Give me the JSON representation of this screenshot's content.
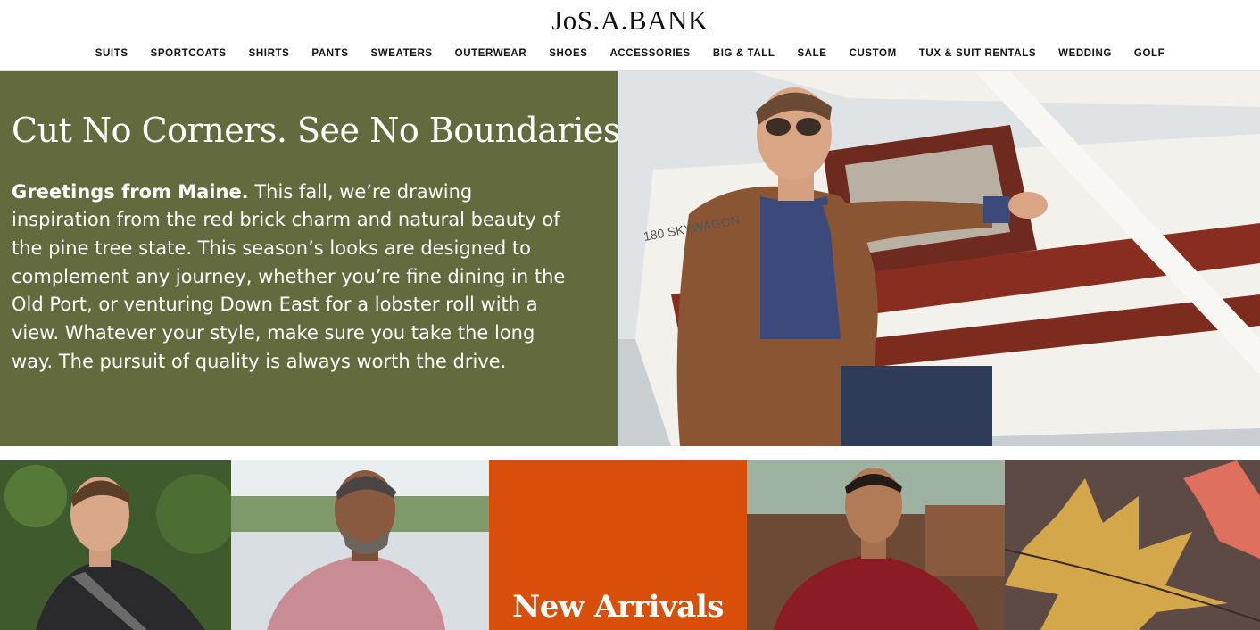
{
  "brand": {
    "logo": "JoS.A.BANK"
  },
  "nav": {
    "items": [
      {
        "label": "SUITS"
      },
      {
        "label": "SPORTCOATS"
      },
      {
        "label": "SHIRTS"
      },
      {
        "label": "PANTS"
      },
      {
        "label": "SWEATERS"
      },
      {
        "label": "OUTERWEAR"
      },
      {
        "label": "SHOES"
      },
      {
        "label": "ACCESSORIES"
      },
      {
        "label": "BIG & TALL"
      },
      {
        "label": "SALE"
      },
      {
        "label": "CUSTOM"
      },
      {
        "label": "TUX & SUIT RENTALS"
      },
      {
        "label": "WEDDING"
      },
      {
        "label": "GOLF"
      }
    ]
  },
  "hero": {
    "title": "Cut No Corners. See No Boundaries.",
    "lead": "Greetings from Maine.",
    "body": " This fall, we’re drawing inspiration from the red brick charm and natural beauty of the pine tree state. This season’s looks are designed to complement any journey, whether you’re fine dining in the Old Port, or venturing Down East for a lobster roll with a view. Whatever your style, make sure you take the long way. The pursuit of quality is always worth the drive.",
    "plane_text": "180 SKYWAGON"
  },
  "tiles": {
    "new_arrivals_label": "New Arrivals"
  },
  "colors": {
    "hero_panel": "#636b3e",
    "new_arrivals": "#d94f0a"
  }
}
